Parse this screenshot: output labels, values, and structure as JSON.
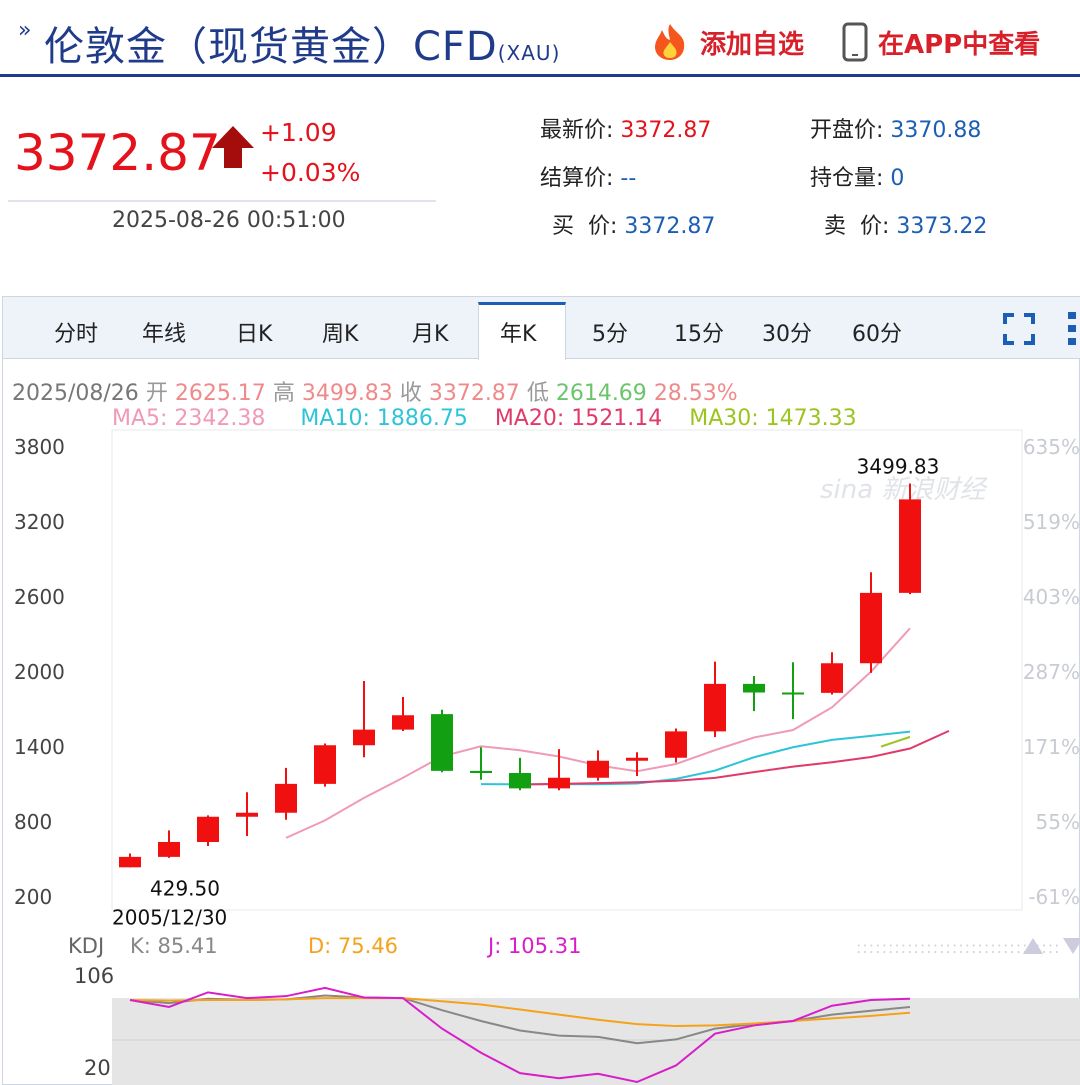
{
  "header": {
    "title": "伦敦金（现货黄金）CFD",
    "code": "(XAU)",
    "watch_label": "添加自选",
    "app_label": "在APP中查看"
  },
  "quote": {
    "price": "3372.87",
    "change": "+1.09",
    "change_pct": "+0.03%",
    "time": "2025-08-26 00:51:00",
    "latest_label": "最新价:",
    "latest_value": "3372.87",
    "open_label": "开盘价:",
    "open_value": "3370.88",
    "settle_label": "结算价:",
    "settle_value": "--",
    "oi_label": "持仓量:",
    "oi_value": "0",
    "bid_label": "买  价:",
    "bid_value": "3372.87",
    "ask_label": "卖  价:",
    "ask_value": "3373.22"
  },
  "tabs": [
    "分时",
    "年线",
    "日K",
    "周K",
    "月K",
    "年K",
    "5分",
    "15分",
    "30分",
    "60分"
  ],
  "active_tab": "年K",
  "info": {
    "date": "2025/08/26",
    "open_label": "开",
    "open": "2625.17",
    "high_label": "高",
    "high": "3499.83",
    "close_label": "收",
    "close": "3372.87",
    "low_label": "低",
    "low": "2614.69",
    "pct": "28.53%",
    "ma5": "MA5: 2342.38",
    "ma10": "MA10: 1886.75",
    "ma20": "MA20: 1521.14",
    "ma30": "MA30: 1473.33"
  },
  "kdj": {
    "label": "KDJ",
    "k": "K: 85.41",
    "d": "D: 75.46",
    "j": "J: 105.31",
    "ticks": [
      "106",
      "20"
    ]
  },
  "colors": {
    "up": "#f01010",
    "down": "#12a012",
    "ma5": "#f09ab5",
    "ma10": "#2ec4d8",
    "ma20": "#e0396a",
    "ma30": "#9cc41e",
    "k": "#888888",
    "d": "#f5a21b",
    "j": "#d81ec8",
    "accent": "#1b5eb5"
  },
  "chart_data": {
    "type": "candlestick",
    "ylim": [
      200,
      3800
    ],
    "yticks": [
      3800,
      3200,
      2600,
      2000,
      1400,
      800,
      200
    ],
    "pct_ticks": [
      "635%",
      "519%",
      "403%",
      "287%",
      "171%",
      "55%",
      "-61%"
    ],
    "max_label": "3499.83",
    "min_label": "429.50",
    "min_date": "2005/12/30",
    "watermark": "新浪财经",
    "candles": [
      {
        "o": 429.5,
        "c": 513,
        "h": 540,
        "l": 429.5
      },
      {
        "o": 513,
        "c": 632,
        "h": 725,
        "l": 505
      },
      {
        "o": 632,
        "c": 834,
        "h": 845,
        "l": 600
      },
      {
        "o": 834,
        "c": 866,
        "h": 1030,
        "l": 680
      },
      {
        "o": 866,
        "c": 1097,
        "h": 1225,
        "l": 810
      },
      {
        "o": 1097,
        "c": 1406,
        "h": 1420,
        "l": 1075
      },
      {
        "o": 1406,
        "c": 1531,
        "h": 1920,
        "l": 1310
      },
      {
        "o": 1531,
        "c": 1646,
        "h": 1792,
        "l": 1520
      },
      {
        "o": 1655,
        "c": 1201,
        "h": 1690,
        "l": 1190
      },
      {
        "o": 1201,
        "c": 1184,
        "h": 1390,
        "l": 1130
      },
      {
        "o": 1184,
        "c": 1061,
        "h": 1305,
        "l": 1046
      },
      {
        "o": 1061,
        "c": 1146,
        "h": 1375,
        "l": 1046
      },
      {
        "o": 1146,
        "c": 1282,
        "h": 1365,
        "l": 1123
      },
      {
        "o": 1282,
        "c": 1306,
        "h": 1350,
        "l": 1160
      },
      {
        "o": 1306,
        "c": 1517,
        "h": 1540,
        "l": 1268
      },
      {
        "o": 1517,
        "c": 1897,
        "h": 2075,
        "l": 1471
      },
      {
        "o": 1897,
        "c": 1828,
        "h": 1960,
        "l": 1679
      },
      {
        "o": 1828,
        "c": 1825,
        "h": 2070,
        "l": 1615
      },
      {
        "o": 1825,
        "c": 2062,
        "h": 2150,
        "l": 1812
      },
      {
        "o": 2062,
        "c": 2625,
        "h": 2790,
        "l": 1985
      },
      {
        "o": 2625,
        "c": 3372.87,
        "h": 3499.83,
        "l": 2614.69
      }
    ],
    "ma5": [
      null,
      null,
      null,
      null,
      665,
      805,
      985,
      1146,
      1317,
      1398,
      1366,
      1316,
      1245,
      1198,
      1256,
      1367,
      1468,
      1528,
      1709,
      1995,
      2342
    ],
    "ma10": [
      null,
      null,
      null,
      null,
      null,
      null,
      null,
      null,
      null,
      1095,
      1093,
      1095,
      1094,
      1100,
      1137,
      1203,
      1310,
      1390,
      1449,
      1481,
      1515
    ],
    "ma20": [
      null,
      null,
      null,
      null,
      null,
      null,
      null,
      null,
      null,
      null,
      1092,
      1097,
      1103,
      1110,
      1122,
      1145,
      1191,
      1235,
      1270,
      1312,
      1380,
      1521
    ],
    "ma30": [
      null,
      null,
      null,
      null,
      null,
      null,
      null,
      null,
      null,
      null,
      null,
      null,
      null,
      null,
      null,
      null,
      null,
      null,
      null,
      null,
      1473
    ],
    "kdj_k": [
      103,
      98,
      105,
      103,
      104,
      110,
      107,
      106,
      87,
      70,
      55,
      47,
      45,
      35,
      41,
      58,
      65,
      70,
      80,
      86,
      92
    ],
    "kdj_d": [
      103,
      102,
      103,
      103,
      104,
      106,
      106,
      106,
      101,
      96,
      88,
      80,
      72,
      65,
      62,
      63,
      66,
      70,
      74,
      78,
      83
    ],
    "kdj_j": [
      103,
      92,
      115,
      106,
      109,
      122,
      107,
      106,
      58,
      20,
      -12,
      -20,
      -13,
      -26,
      0,
      50,
      63,
      70,
      94,
      103,
      105
    ]
  }
}
